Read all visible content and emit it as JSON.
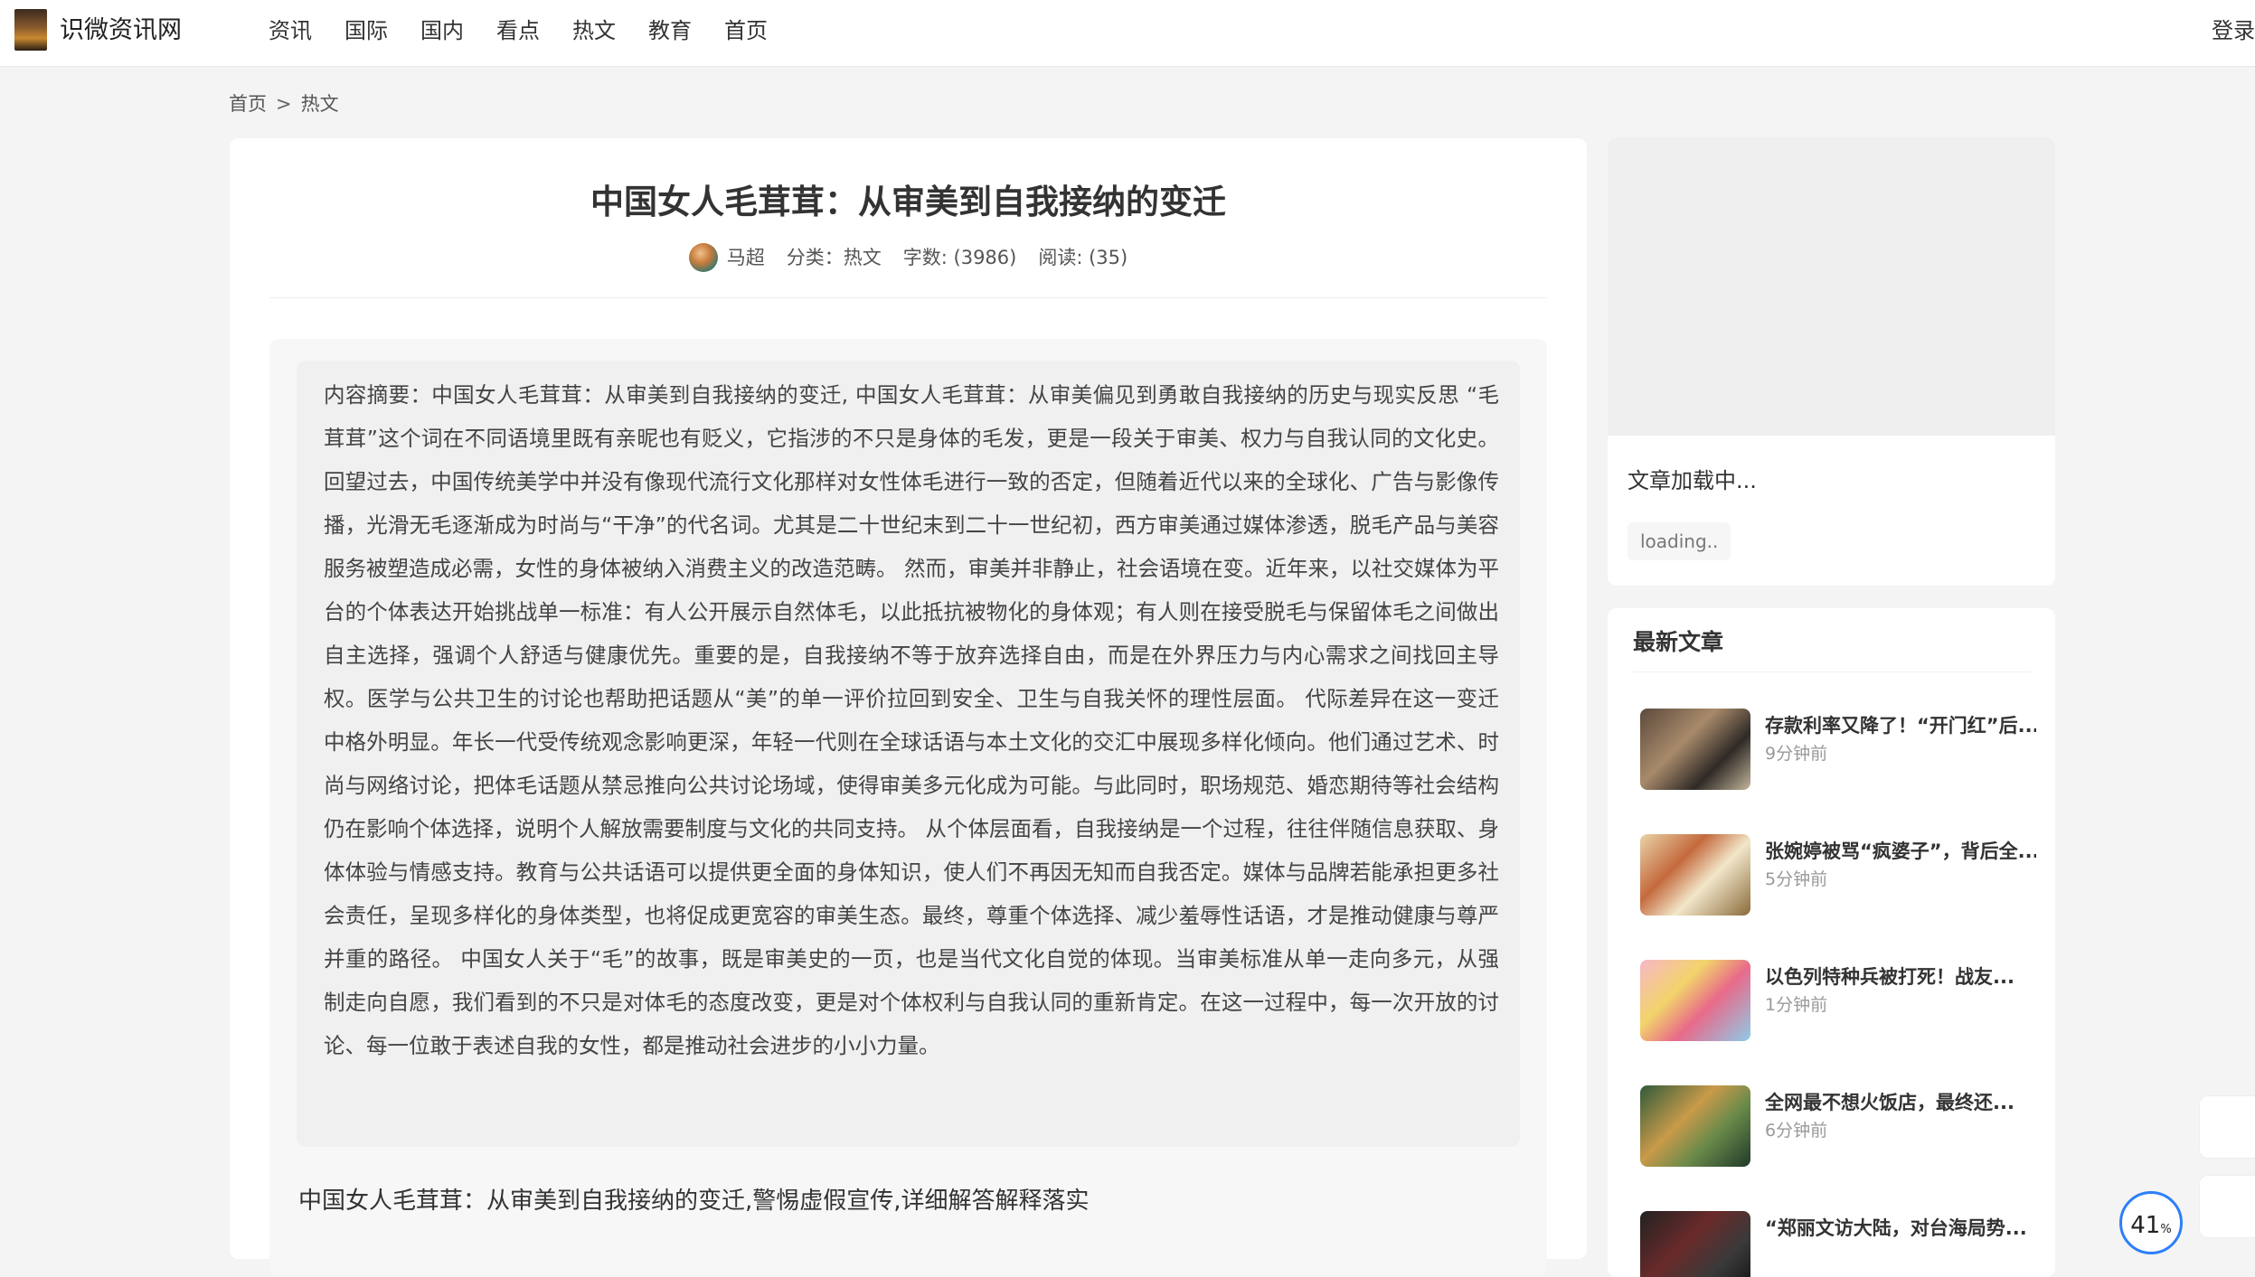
{
  "header": {
    "site_name": "识微资讯网",
    "nav": [
      "资讯",
      "国际",
      "国内",
      "看点",
      "热文",
      "教育",
      "首页"
    ],
    "login": "登录"
  },
  "breadcrumb": {
    "home": "首页",
    "separator": ">",
    "current": "热文"
  },
  "article": {
    "title": "中国女人毛茸茸：从审美到自我接纳的变迁",
    "author": "马超",
    "category": "分类：热文",
    "word_count": "字数: (3986)",
    "reads": "阅读: (35)",
    "summary": "内容摘要：中国女人毛茸茸：从审美到自我接纳的变迁, 中国女人毛茸茸：从审美偏见到勇敢自我接纳的历史与现实反思 “毛茸茸”这个词在不同语境里既有亲昵也有贬义，它指涉的不只是身体的毛发，更是一段关于审美、权力与自我认同的文化史。回望过去，中国传统美学中并没有像现代流行文化那样对女性体毛进行一致的否定，但随着近代以来的全球化、广告与影像传播，光滑无毛逐渐成为时尚与“干净”的代名词。尤其是二十世纪末到二十一世纪初，西方审美通过媒体渗透，脱毛产品与美容服务被塑造成必需，女性的身体被纳入消费主义的改造范畴。 然而，审美并非静止，社会语境在变。近年来，以社交媒体为平台的个体表达开始挑战单一标准：有人公开展示自然体毛，以此抵抗被物化的身体观；有人则在接受脱毛与保留体毛之间做出自主选择，强调个人舒适与健康优先。重要的是，自我接纳不等于放弃选择自由，而是在外界压力与内心需求之间找回主导权。医学与公共卫生的讨论也帮助把话题从“美”的单一评价拉回到安全、卫生与自我关怀的理性层面。 代际差异在这一变迁中格外明显。年长一代受传统观念影响更深，年轻一代则在全球话语与本土文化的交汇中展现多样化倾向。他们通过艺术、时尚与网络讨论，把体毛话题从禁忌推向公共讨论场域，使得审美多元化成为可能。与此同时，职场规范、婚恋期待等社会结构仍在影响个体选择，说明个人解放需要制度与文化的共同支持。 从个体层面看，自我接纳是一个过程，往往伴随信息获取、身体体验与情感支持。教育与公共话语可以提供更全面的身体知识，使人们不再因无知而自我否定。媒体与品牌若能承担更多社会责任，呈现多样化的身体类型，也将促成更宽容的审美生态。最终，尊重个体选择、减少羞辱性话语，才是推动健康与尊严并重的路径。 中国女人关于“毛”的故事，既是审美史的一页，也是当代文化自觉的体现。当审美标准从单一走向多元，从强制走向自愿，我们看到的不只是对体毛的态度改变，更是对个体权利与自我认同的重新肯定。在这一过程中，每一次开放的讨论、每一位敢于表述自我的女性，都是推动社会进步的小小力量。",
    "body_first_line": "中国女人毛茸茸：从审美到自我接纳的变迁,警惕虚假宣传,详细解答解释落实"
  },
  "sidebar": {
    "loading_title": "文章加载中...",
    "loading_tag": "loading..",
    "latest_title": "最新文章",
    "news": [
      {
        "title": "存款利率又降了！“开门红”后...",
        "time": "9分钟前"
      },
      {
        "title": "张婉婷被骂“疯婆子”，背后全...",
        "time": "5分钟前"
      },
      {
        "title": "以色列特种兵被打死！战友...",
        "time": "1分钟前"
      },
      {
        "title": "全网最不想火饭店，最终还...",
        "time": "6分钟前"
      },
      {
        "title": "“郑丽文访大陆，对台海局势...",
        "time": ""
      }
    ]
  },
  "reading_progress": {
    "value": "41",
    "unit": "%"
  },
  "colors": {
    "accent": "#2d7ff9",
    "background": "#f4f4f4",
    "card": "#ffffff"
  }
}
